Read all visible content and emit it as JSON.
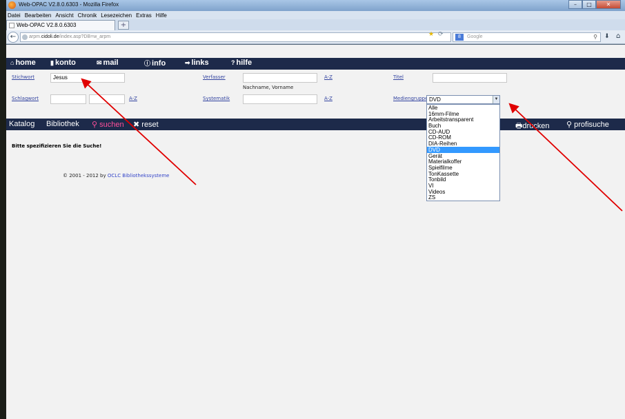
{
  "window": {
    "title": "Web-OPAC V2.8.0.6303 - Mozilla Firefox",
    "buttons": {
      "minimize": "–",
      "maximize": "□",
      "close": "✕"
    }
  },
  "menubar": [
    "Datei",
    "Bearbeiten",
    "Ansicht",
    "Chronik",
    "Lesezeichen",
    "Extras",
    "Hilfe"
  ],
  "tab": {
    "label": "Web-OPAC V2.8.0.6303",
    "new_tab": "+"
  },
  "urlbar": {
    "domain_prefix": "arpm.",
    "domain": "cidoli.de",
    "path": "/index.asp?DB=w_arpm"
  },
  "search_engine": {
    "badge": "8",
    "placeholder": "Google"
  },
  "topnav": [
    {
      "icon": "⌂",
      "label": "home"
    },
    {
      "icon": "▮",
      "label": "konto"
    },
    {
      "icon": "✉",
      "label": "mail"
    },
    {
      "icon": "ⓘ",
      "label": "info"
    },
    {
      "icon": "➡",
      "label": "links"
    },
    {
      "icon": "?",
      "label": "hilfe"
    }
  ],
  "form": {
    "stichwort": {
      "label": "Stichwort",
      "value": "Jesus"
    },
    "verfasser": {
      "label": "Verfasser",
      "value": "",
      "hint": "Nachname, Vorname",
      "az": "A-Z"
    },
    "titel": {
      "label": "Titel",
      "value": ""
    },
    "schlagwort": {
      "label": "Schlagwort",
      "value1": "",
      "value2": "",
      "az": "A-Z"
    },
    "systematik": {
      "label": "Systematik",
      "value": "",
      "az": "A-Z"
    },
    "mediengruppe": {
      "label": "Mediengruppe",
      "value": "DVD",
      "options": [
        "Alle",
        "16mm-Filme",
        "Arbeitstransparent",
        "Buch",
        "CD-AUD",
        "CD-ROM",
        "DIA-Reihen",
        "DVD",
        "Gerät",
        "Materialkoffer",
        "Spielfilme",
        "TonKassette",
        "Tonbild",
        "VI",
        "Videos",
        "ZS"
      ],
      "selected_index": 7
    }
  },
  "subnav": {
    "katalog": "Katalog",
    "bibliothek": "Bibliothek",
    "suchen": "suchen",
    "reset": "reset",
    "drucken": "drucken",
    "profisuche": "profisuche"
  },
  "message": "Bitte spezifizieren Sie die Suche!",
  "footer": {
    "copyright": "© 2001 - 2012 by",
    "link": "OCLC Bibliothekssysteme"
  },
  "colors": {
    "nav_bg": "#1d2a4a",
    "active_link": "#ff4f9a",
    "annotation_arrow": "#e00000",
    "selected_option": "#3399ff"
  }
}
